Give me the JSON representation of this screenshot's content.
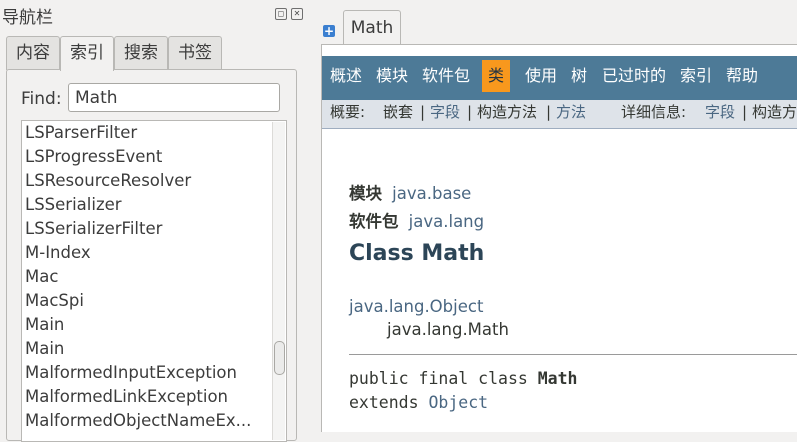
{
  "dock": {
    "title": "导航栏",
    "float_glyph": "◻",
    "close_glyph": "✕",
    "tabs": [
      "内容",
      "索引",
      "搜索",
      "书签"
    ],
    "active_tab": "索引",
    "find_label": "Find:",
    "find_value": "Math",
    "items": [
      "LSParserFilter",
      "LSProgressEvent",
      "LSResourceResolver",
      "LSSerializer",
      "LSSerializerFilter",
      "M-Index",
      "Mac",
      "MacSpi",
      "Main",
      "Main",
      "MalformedInputException",
      "MalformedLinkException",
      "MalformedObjectNameEx..."
    ]
  },
  "doc_tab": {
    "add_glyph": "+",
    "label": "Math"
  },
  "navbar": {
    "items": [
      "概述",
      "模块",
      "软件包",
      "类",
      "使用",
      "树",
      "已过时的",
      "索引",
      "帮助"
    ],
    "active": "类"
  },
  "subnav": {
    "summary_label": "概要:",
    "nested": "嵌套",
    "sep": "|",
    "field": "字段",
    "constructor": "构造方法",
    "method": "方法",
    "detail_label": "详细信息:",
    "detail_field": "字段",
    "detail_constructor": "构造方"
  },
  "content": {
    "module_label": "模块",
    "module_value": "java.base",
    "package_label": "软件包",
    "package_value": "java.lang",
    "class_title": "Class Math",
    "inherit_parent": "java.lang.Object",
    "inherit_child": "java.lang.Math",
    "decl_prefix": "public final class ",
    "decl_name": "Math",
    "extends_kw": "extends ",
    "extends_type": "Object"
  },
  "colors": {
    "navbar_bg": "#4d7a97",
    "navbar_active_bg": "#f8981d",
    "subnav_bg": "#dee3e9",
    "link": "#4a6782",
    "title": "#2c4557"
  }
}
